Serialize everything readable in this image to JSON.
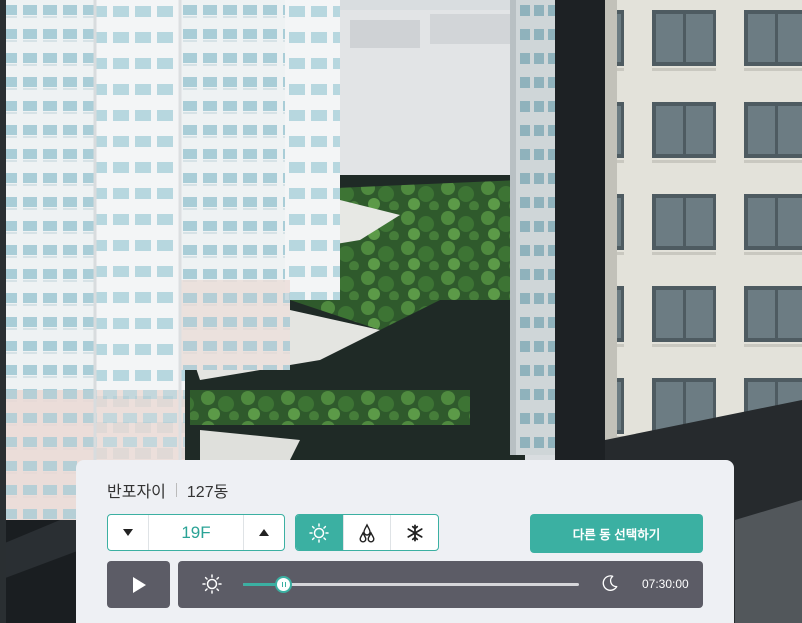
{
  "panel": {
    "complex_name": "반포자이",
    "building": "127동"
  },
  "floor": {
    "value": "19F",
    "down_icon": "triangle-down-icon",
    "up_icon": "triangle-up-icon"
  },
  "weather": {
    "options": [
      {
        "icon": "sun-icon",
        "active": true
      },
      {
        "icon": "rain-drops-icon",
        "active": false
      },
      {
        "icon": "snowflake-icon",
        "active": false
      }
    ]
  },
  "select_other_button": "다른 동 선택하기",
  "playback": {
    "play_icon": "play-icon"
  },
  "timeline": {
    "start_icon": "sun-icon",
    "end_icon": "moon-icon",
    "position_percent": 12,
    "time": "07:30:00"
  },
  "colors": {
    "accent": "#3bb0a2",
    "dark": "#5c5c66",
    "panel": "#eef0f4"
  }
}
